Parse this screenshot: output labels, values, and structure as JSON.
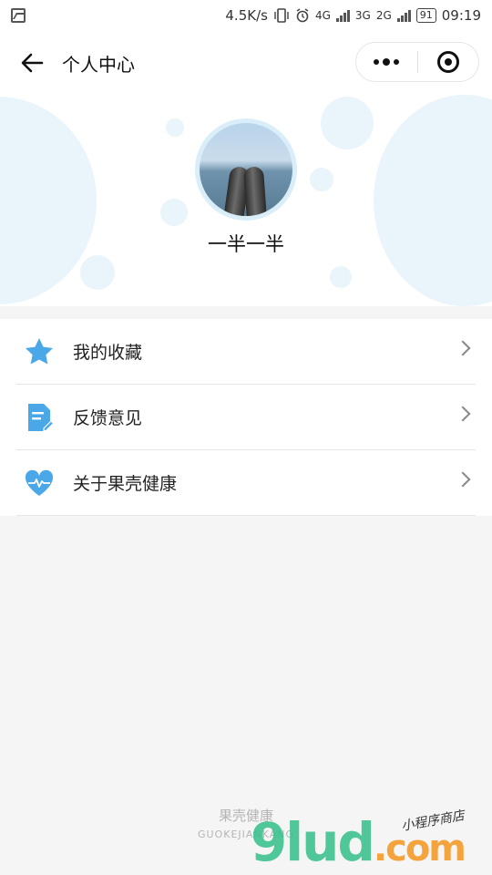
{
  "status_bar": {
    "speed": "4.5K/s",
    "net1": "4G",
    "net2": "3G",
    "net3": "2G",
    "battery": "91",
    "time": "09:19"
  },
  "nav": {
    "title": "个人中心"
  },
  "profile": {
    "username": "一半一半"
  },
  "menu": {
    "items": [
      {
        "label": "我的收藏",
        "icon": "star-icon",
        "color": "#4aa8e8"
      },
      {
        "label": "反馈意见",
        "icon": "document-edit-icon",
        "color": "#4aa8e8"
      },
      {
        "label": "关于果壳健康",
        "icon": "heart-pulse-icon",
        "color": "#4aa8e8"
      }
    ]
  },
  "footer": {
    "brand_cn": "果壳健康",
    "brand_en": "GUOKEJIANKANG"
  },
  "watermark": {
    "text_main": "9lud",
    "text_com": ".com",
    "text_sub": "小程序商店"
  },
  "colors": {
    "accent": "#4aa8e8",
    "bubble": "#eaf4fb",
    "background": "#f5f5f5"
  }
}
